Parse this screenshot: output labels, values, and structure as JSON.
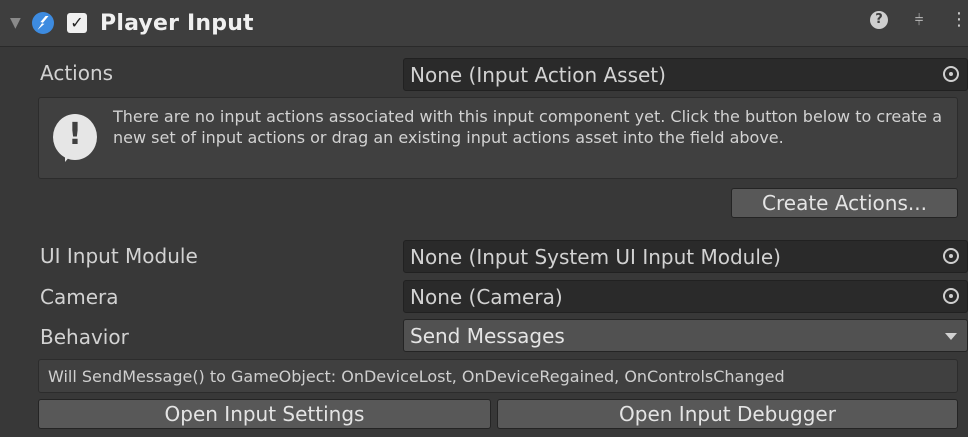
{
  "header": {
    "title": "Player Input",
    "enabled_checkmark": "✓",
    "foldout_icon": "triangle-down",
    "component_icon": "player-input-icon",
    "help_icon": "?",
    "preset_icon": "⫩",
    "menu_icon": "⋮"
  },
  "actions": {
    "label": "Actions",
    "value": "None (Input Action Asset)"
  },
  "help_box": {
    "icon": "!",
    "text": "There are no input actions associated with this input component yet. Click the button below to create a new set of input actions or drag an existing input actions asset into the field above."
  },
  "create_actions_button": "Create Actions...",
  "ui_input_module": {
    "label": "UI Input Module",
    "value": "None (Input System UI Input Module)"
  },
  "camera": {
    "label": "Camera",
    "value": "None (Camera)"
  },
  "behavior": {
    "label": "Behavior",
    "value": "Send Messages"
  },
  "info_text": "Will SendMessage() to GameObject: OnDeviceLost, OnDeviceRegained, OnControlsChanged",
  "buttons": {
    "open_settings": "Open Input Settings",
    "open_debugger": "Open Input Debugger"
  },
  "colors": {
    "background": "#383838",
    "field": "#2a2a2a",
    "button": "#585858",
    "component_icon": "#3d8be0"
  }
}
